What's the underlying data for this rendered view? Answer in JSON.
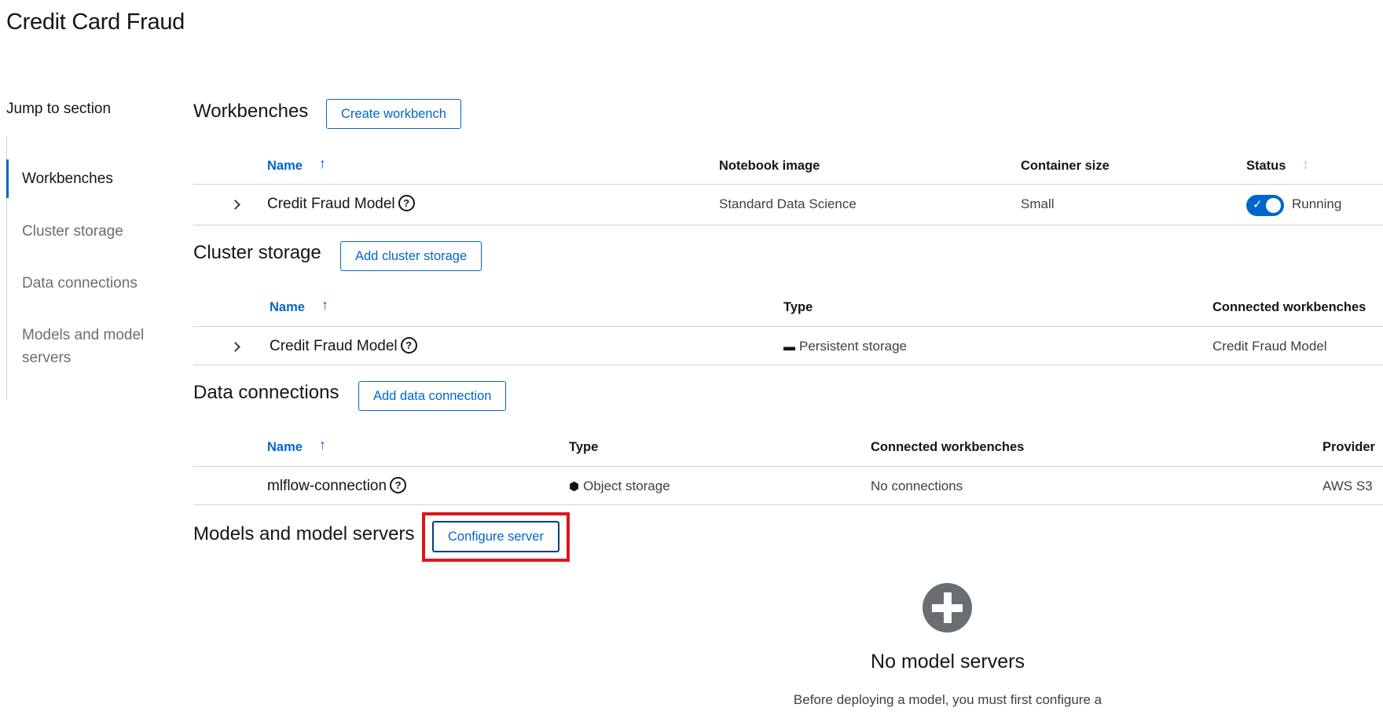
{
  "page": {
    "title": "Credit Card Fraud"
  },
  "jump_nav": {
    "label": "Jump to section",
    "items": [
      {
        "label": "Workbenches",
        "active": true
      },
      {
        "label": "Cluster storage",
        "active": false
      },
      {
        "label": "Data connections",
        "active": false
      },
      {
        "label": "Models and model servers",
        "active": false
      }
    ]
  },
  "workbenches": {
    "title": "Workbenches",
    "button": "Create workbench",
    "columns": {
      "name": "Name",
      "image": "Notebook image",
      "size": "Container size",
      "status": "Status"
    },
    "rows": [
      {
        "name": "Credit Fraud Model",
        "image": "Standard Data Science",
        "size": "Small",
        "status": "Running",
        "enabled": true
      }
    ]
  },
  "cluster_storage": {
    "title": "Cluster storage",
    "button": "Add cluster storage",
    "columns": {
      "name": "Name",
      "type": "Type",
      "connected": "Connected workbenches"
    },
    "rows": [
      {
        "name": "Credit Fraud Model",
        "type": "Persistent storage",
        "type_icon": "storage-drive-icon",
        "connected": "Credit Fraud Model"
      }
    ]
  },
  "data_connections": {
    "title": "Data connections",
    "button": "Add data connection",
    "columns": {
      "name": "Name",
      "type": "Type",
      "connected": "Connected workbenches",
      "provider": "Provider"
    },
    "rows": [
      {
        "name": "mlflow-connection",
        "type": "Object storage",
        "type_icon": "cube-icon",
        "connected": "No connections",
        "provider": "AWS S3"
      }
    ]
  },
  "models": {
    "title": "Models and model servers",
    "button": "Configure server",
    "empty_title": "No model servers",
    "empty_body": "Before deploying a model, you must first configure a"
  },
  "icons": {
    "help": "?",
    "sort_asc": "↑",
    "sort_both": "↕",
    "check": "✓",
    "drive": "▬",
    "cube": "⬢"
  },
  "colors": {
    "accent": "#0066cc",
    "highlight": "#e0141e",
    "muted_icon": "#6a6e73"
  }
}
